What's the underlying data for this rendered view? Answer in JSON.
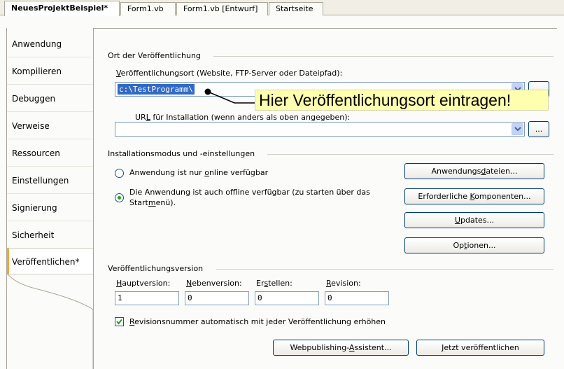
{
  "doc_tabs": [
    {
      "label": "NeuesProjektBeispiel*",
      "active": true
    },
    {
      "label": "Form1.vb",
      "active": false
    },
    {
      "label": "Form1.vb [Entwurf]",
      "active": false
    },
    {
      "label": "Startseite",
      "active": false
    }
  ],
  "side_tabs": [
    {
      "label": "Anwendung"
    },
    {
      "label": "Kompilieren"
    },
    {
      "label": "Debuggen"
    },
    {
      "label": "Verweise"
    },
    {
      "label": "Ressourcen"
    },
    {
      "label": "Einstellungen"
    },
    {
      "label": "Signierung"
    },
    {
      "label": "Sicherheit"
    },
    {
      "label": "Veröffentlichen*",
      "active": true
    }
  ],
  "publish_location": {
    "group_title": "Ort der Veröffentlichung",
    "location_label_u": "V",
    "location_label_rest": "eröffentlichungsort (Website, FTP-Server oder Dateipfad):",
    "location_value": "c:\\TestProgramm\\",
    "url_label_pre": "UR",
    "url_label_u": "L",
    "url_label_rest": " für Installation (wenn anders als oben angegeben):",
    "url_value": "",
    "browse_label": "..."
  },
  "callout": {
    "text": "Hier Veröffentlichungsort eintragen!"
  },
  "install_mode": {
    "group_title": "Installationsmodus und -einstellungen",
    "online_pre": "Anwendung ist nur ",
    "online_u": "o",
    "online_rest": "nline verfügbar",
    "offline_line1": "Die Anwendung ist auch offline verfügbar (zu starten über das",
    "offline_line2_pre": "Start",
    "offline_line2_u": "m",
    "offline_line2_rest": "enü).",
    "selected": "offline",
    "buttons": {
      "files_pre": "Anwendungs",
      "files_u": "d",
      "files_rest": "ateien...",
      "prereq_pre": "Erforderliche ",
      "prereq_u": "K",
      "prereq_rest": "omponenten...",
      "updates_u": "U",
      "updates_rest": "pdates...",
      "options_pre": "Op",
      "options_u": "t",
      "options_rest": "ionen..."
    }
  },
  "version": {
    "group_title": "Veröffentlichungsversion",
    "major_u": "H",
    "major_rest": "auptversion:",
    "minor_u": "N",
    "minor_rest": "ebenversion:",
    "build_pre": "Er",
    "build_u": "s",
    "build_rest": "tellen:",
    "revision_u": "R",
    "revision_rest": "evision:",
    "major": "1",
    "minor": "0",
    "build": "0",
    "revision": "0",
    "auto_increment_u": "R",
    "auto_increment_rest": "evisionsnummer automatisch mit jeder Veröffentlichung erhöhen",
    "auto_increment_checked": true
  },
  "actions": {
    "wizard_pre": "Webpublishing-",
    "wizard_u": "A",
    "wizard_rest": "ssistent...",
    "publish_u": "J",
    "publish_rest": "etzt veröffentlichen"
  }
}
